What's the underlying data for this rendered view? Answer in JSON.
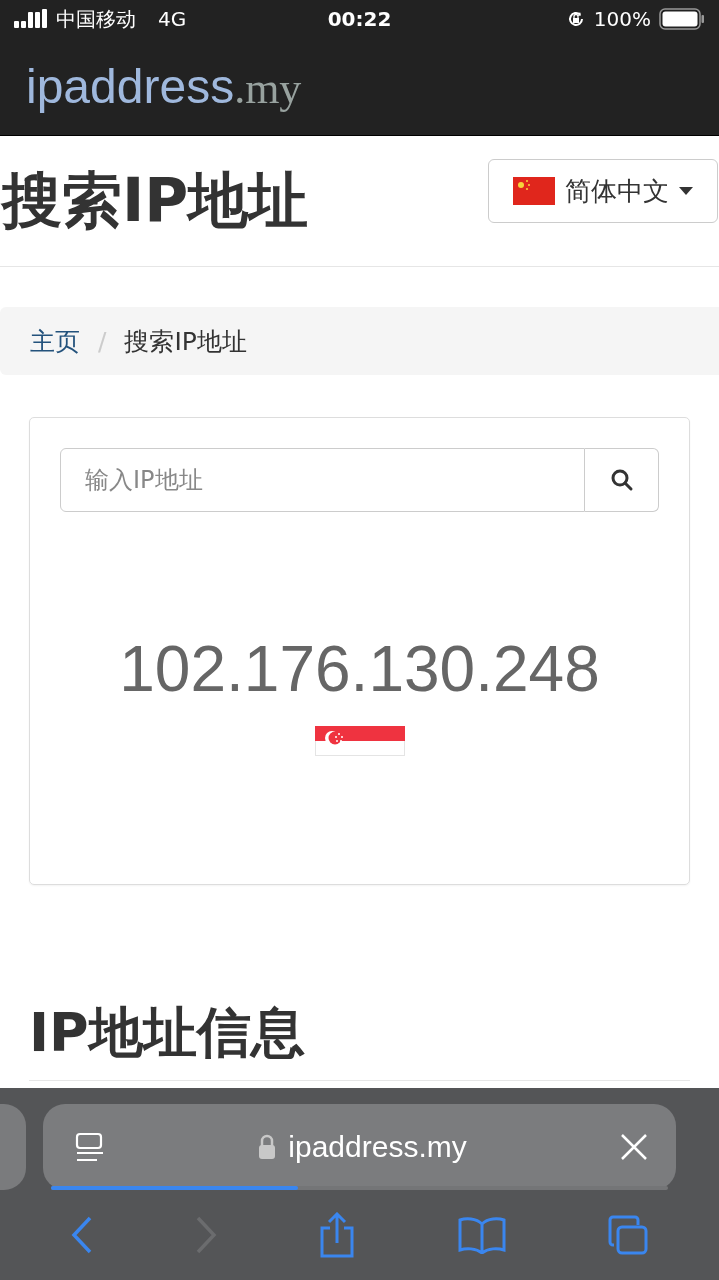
{
  "status_bar": {
    "carrier": "中国移动",
    "network": "4G",
    "time": "00:22",
    "battery": "100%"
  },
  "site_header": {
    "logo_name": "ipaddress",
    "logo_domain": ".my"
  },
  "page": {
    "title": "搜索IP地址",
    "language": "简体中文",
    "breadcrumb": [
      {
        "label": "主页",
        "kind": "link"
      },
      {
        "label": "搜索IP地址",
        "kind": "current"
      }
    ],
    "breadcrumb_separator": "/",
    "search": {
      "placeholder": "输入IP地址"
    },
    "ip_address": "102.176.130.248",
    "section_heading": "IP地址信息"
  },
  "browser": {
    "url": "ipaddress.my",
    "progress": {
      "level": 0.4
    },
    "toolbar": [
      {
        "kind": "back",
        "disabled": false
      },
      {
        "kind": "forward",
        "disabled": true
      },
      {
        "kind": "share",
        "disabled": false
      },
      {
        "kind": "bookmarks",
        "disabled": false
      },
      {
        "kind": "tabs",
        "disabled": false
      }
    ]
  }
}
